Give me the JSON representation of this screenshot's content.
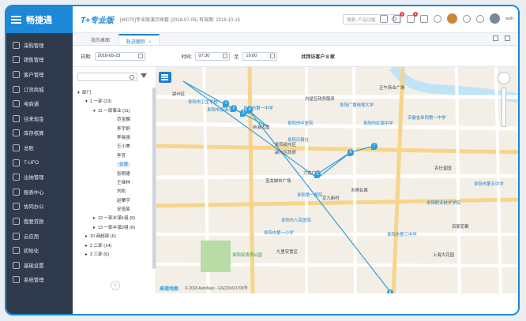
{
  "brand": {
    "name": "畅捷通"
  },
  "sidebar": {
    "items": [
      {
        "label": "采购管理"
      },
      {
        "label": "销售管理"
      },
      {
        "label": "客户管理"
      },
      {
        "label": "订货商城"
      },
      {
        "label": "电商通"
      },
      {
        "label": "往来现金"
      },
      {
        "label": "库存核算"
      },
      {
        "label": "总账"
      },
      {
        "label": "T-UFO"
      },
      {
        "label": "出纳管理"
      },
      {
        "label": "报表中心"
      },
      {
        "label": "协同办公"
      },
      {
        "label": "我要贷款"
      },
      {
        "label": "云应用"
      },
      {
        "label": "初始化"
      },
      {
        "label": "基础设置"
      },
      {
        "label": "系统管理"
      }
    ]
  },
  "topbar": {
    "product": "T+专业版",
    "account_info": "[60070]专业版演示账套   (2018-07-05)   有效期: 2018-10-15",
    "search_placeholder": "搜索: 产品功能",
    "badges": [
      "2",
      "6"
    ],
    "user": "wzh"
  },
  "tabs": [
    {
      "label": "我的桌面",
      "active": false
    },
    {
      "label": "轨迹跟踪",
      "active": true,
      "close": "×"
    }
  ],
  "filter": {
    "date_label": "日期:",
    "date_value": "2018-05-23",
    "time_label": "时间:",
    "time_from": "07:30",
    "to_label": "至",
    "time_to": "19:00",
    "summary": "共拜访客户 8 家"
  },
  "tree": {
    "nodes": [
      {
        "label": "部门",
        "level": 0,
        "prefix": "▾"
      },
      {
        "label": "1 一部 (23)",
        "level": 1,
        "prefix": "▾"
      },
      {
        "label": "11 一部事业 (11)",
        "level": 2,
        "prefix": "▾"
      },
      {
        "label": "范宝麟",
        "level": 3
      },
      {
        "label": "李宇舒",
        "level": 3
      },
      {
        "label": "李晓强",
        "level": 3
      },
      {
        "label": "王小美",
        "level": 3
      },
      {
        "label": "李芳",
        "level": 3
      },
      {
        "label": "张翠",
        "level": 3,
        "selected": true
      },
      {
        "label": "张明德",
        "level": 3
      },
      {
        "label": "王继林",
        "level": 3
      },
      {
        "label": "刘松",
        "level": 3
      },
      {
        "label": "赵攀宇",
        "level": 3
      },
      {
        "label": "安笳笑",
        "level": 3
      },
      {
        "label": "12 一部乡镇1组 (6)",
        "level": 2,
        "prefix": "▸"
      },
      {
        "label": "13 一部乡镇2组 (6)",
        "level": 2,
        "prefix": "▸"
      },
      {
        "label": "10 商超部 (6)",
        "level": 1,
        "prefix": "▸"
      },
      {
        "label": "2 二部 (14)",
        "level": 1,
        "prefix": "▸"
      },
      {
        "label": "3 三部 (6)",
        "level": 1,
        "prefix": "▸"
      }
    ],
    "collapse": "‹"
  },
  "map": {
    "labels": [
      {
        "text": "颍州区",
        "class": ""
      },
      {
        "text": "阜阳市卫生学校",
        "class": "blue"
      },
      {
        "text": "阜阳市双清小学",
        "class": "blue"
      },
      {
        "text": "阜阳市第一中学",
        "class": "blue"
      },
      {
        "text": "白堂区政务服务",
        "class": ""
      },
      {
        "text": "阜阳广播电视大学",
        "class": "blue"
      },
      {
        "text": "阜阳市中医院",
        "class": "blue"
      },
      {
        "text": "阜阳市红旗中学",
        "class": "blue"
      },
      {
        "text": "安徽省阜阳第一中学",
        "class": "blue"
      },
      {
        "text": "新港大厦",
        "class": ""
      },
      {
        "text": "阜阳日报社",
        "class": "blue"
      },
      {
        "text": "颍州区政府",
        "class": ""
      },
      {
        "text": "阜阳颍州区",
        "class": ""
      },
      {
        "text": "力达广场",
        "class": ""
      },
      {
        "text": "宝龙城市广场",
        "class": ""
      },
      {
        "text": "天晴名城",
        "class": ""
      },
      {
        "text": "京九新村",
        "class": ""
      },
      {
        "text": "阜阳第一医院",
        "class": "blue"
      },
      {
        "text": "名仕皇园",
        "class": ""
      },
      {
        "text": "阜阳市第五中学",
        "class": "blue"
      },
      {
        "text": "阜阳职业技术学院",
        "class": "blue"
      },
      {
        "text": "阜阳市人民医院",
        "class": "blue"
      },
      {
        "text": "阜阳市第一小学",
        "class": "blue"
      },
      {
        "text": "阜阳双清湾公园",
        "class": "green"
      },
      {
        "text": "九里安置区",
        "class": ""
      },
      {
        "text": "上海大花园",
        "class": ""
      },
      {
        "text": "百家花都",
        "class": ""
      },
      {
        "text": "正午商业广场",
        "class": ""
      },
      {
        "text": "阜阳市第三中学",
        "class": "blue"
      }
    ],
    "markers": [
      "1",
      "2",
      "3",
      "4",
      "5",
      "6",
      "7",
      "8"
    ],
    "copyright": "© 2018 AutoNavi - GS(2016)1709号",
    "logo": "高德地图"
  },
  "colors": {
    "brand": "#1d87d8",
    "sidebar": "#2f3b4c",
    "route": "#2f9fd8"
  }
}
